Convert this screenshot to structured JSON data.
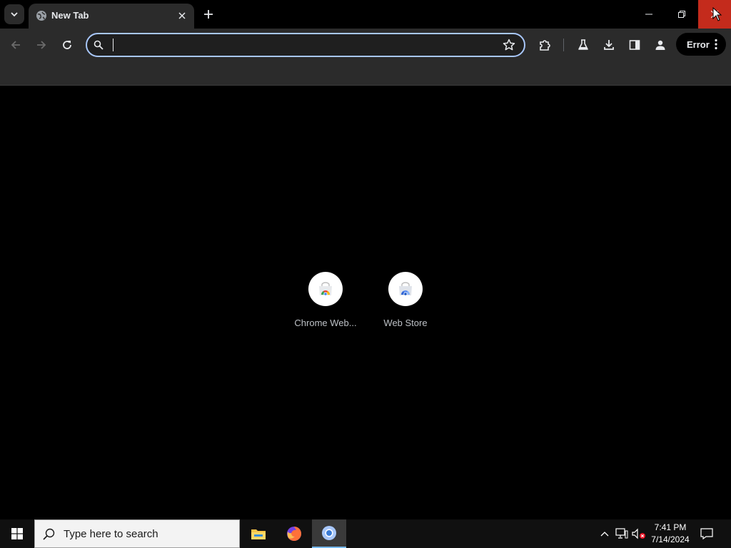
{
  "browser": {
    "tab": {
      "title": "New Tab"
    },
    "omnibox": {
      "value": "",
      "placeholder": ""
    },
    "profile": {
      "label": "Error"
    },
    "colors": {
      "accent": "#a8c7fa",
      "close_hover": "#c42b1c",
      "frame": "#2b2b2b"
    }
  },
  "content": {
    "shortcuts": [
      {
        "label": "Chrome Web...",
        "icon": "chrome-web-store-icon"
      },
      {
        "label": "Web Store",
        "icon": "web-store-icon"
      }
    ]
  },
  "taskbar": {
    "search_placeholder": "Type here to search",
    "apps": [
      "file-explorer-icon",
      "firefox-icon",
      "chrome-icon"
    ],
    "clock": {
      "time": "7:41 PM",
      "date": "7/14/2024"
    }
  }
}
